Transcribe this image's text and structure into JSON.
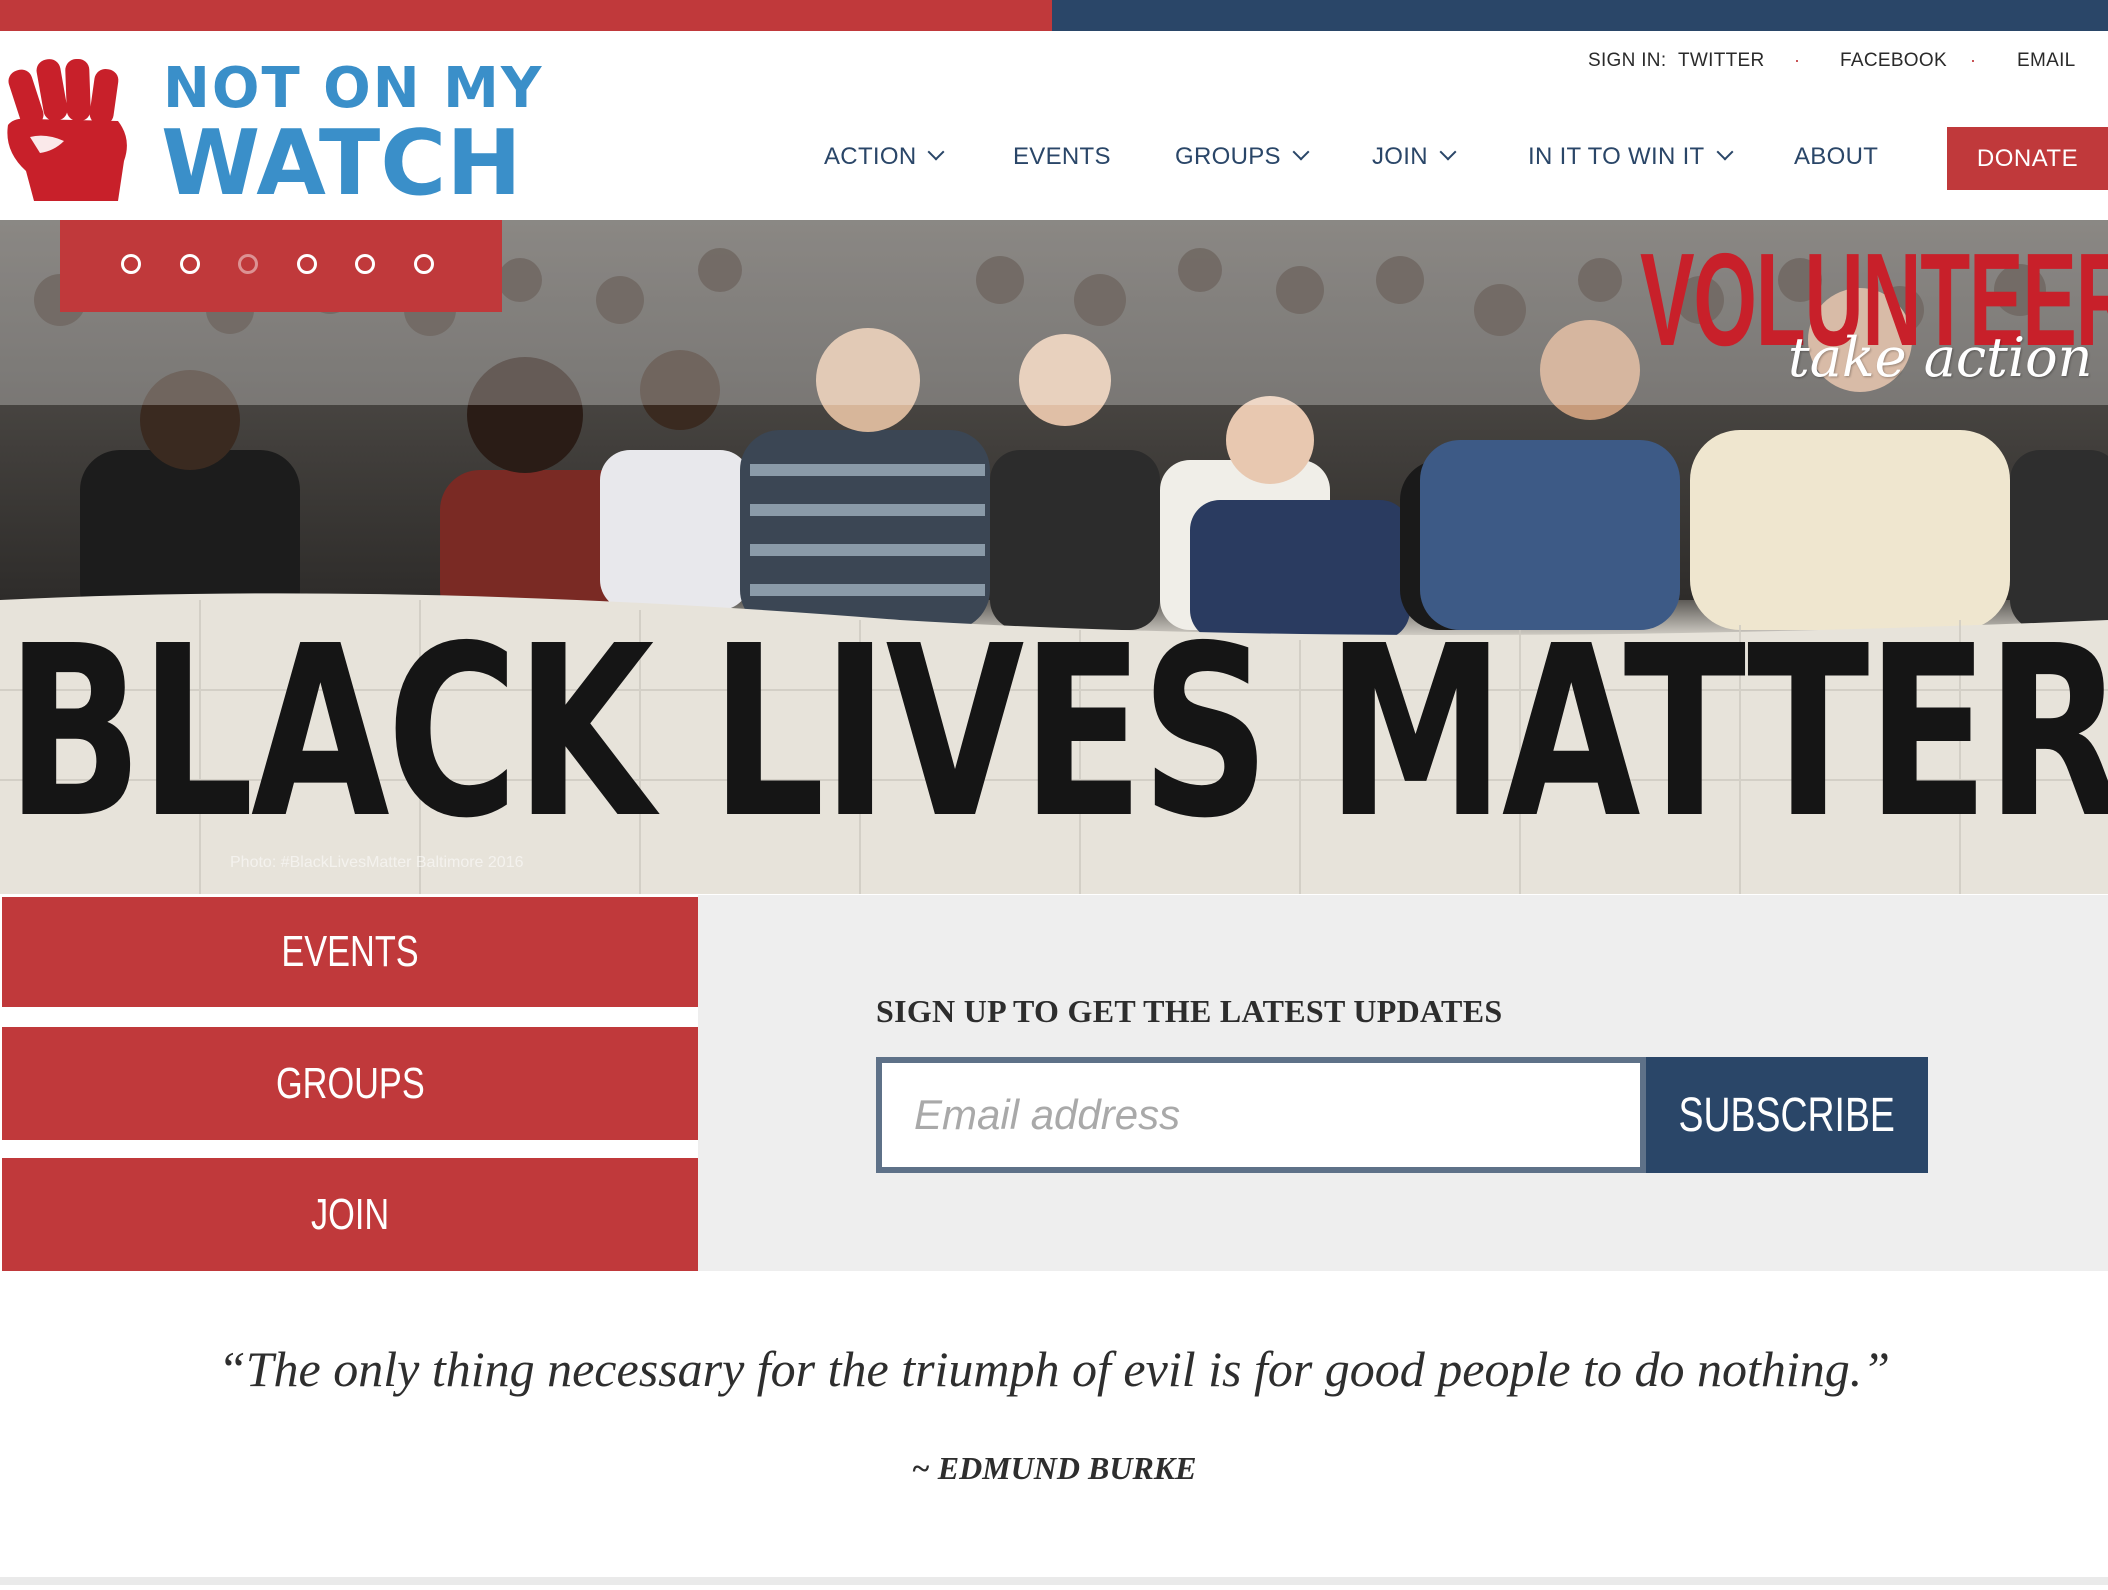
{
  "site": {
    "logo_line1": "NOT ON MY",
    "logo_line2": "WATCH"
  },
  "colors": {
    "brand_red": "#c0393b",
    "brand_navy": "#2a4668",
    "logo_blue": "#3a8fc9"
  },
  "signin": {
    "label": "SIGN IN:",
    "links": [
      "TWITTER",
      "FACEBOOK",
      "EMAIL"
    ],
    "separator": "·"
  },
  "nav": {
    "items": [
      {
        "label": "ACTION",
        "has_dropdown": true
      },
      {
        "label": "EVENTS",
        "has_dropdown": false
      },
      {
        "label": "GROUPS",
        "has_dropdown": true
      },
      {
        "label": "JOIN",
        "has_dropdown": true
      },
      {
        "label": "IN IT TO WIN IT",
        "has_dropdown": true
      },
      {
        "label": "ABOUT",
        "has_dropdown": false
      }
    ],
    "donate_label": "DONATE"
  },
  "hero": {
    "headline": "VOLUNTEER",
    "tagline": "take action",
    "banner_text": "BLACK LIVES MATTER",
    "photo_credit": "Photo: #BlackLivesMatter Baltimore 2016",
    "slide_count": 6,
    "active_slide": 3
  },
  "side_buttons": [
    "EVENTS",
    "GROUPS",
    "JOIN"
  ],
  "signup": {
    "title": "SIGN UP TO GET THE LATEST UPDATES",
    "email_placeholder": "Email address",
    "email_value": "",
    "subscribe_label": "SUBSCRIBE"
  },
  "quote": {
    "text": "“The only thing necessary for the triumph of evil is for good people to do nothing.”",
    "author": "~ EDMUND BURKE"
  }
}
